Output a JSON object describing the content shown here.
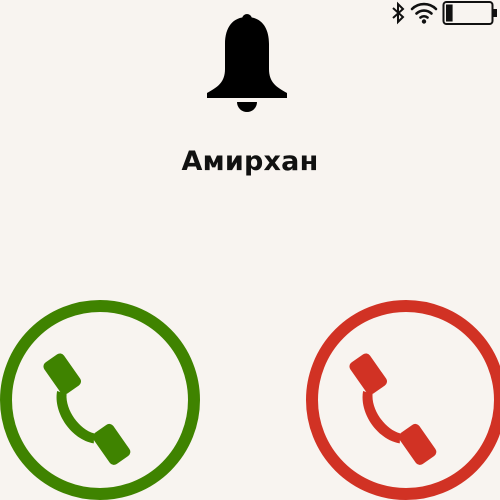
{
  "status_bar": {
    "icons": [
      "bluetooth-icon",
      "wifi-icon",
      "battery-icon"
    ],
    "battery_level": 0.15
  },
  "call": {
    "icon": "bell-icon",
    "caller_name": "Амирхан"
  },
  "actions": {
    "accept": {
      "icon": "phone-icon",
      "color": "#3f8300"
    },
    "decline": {
      "icon": "phone-icon",
      "color": "#d13224"
    }
  }
}
